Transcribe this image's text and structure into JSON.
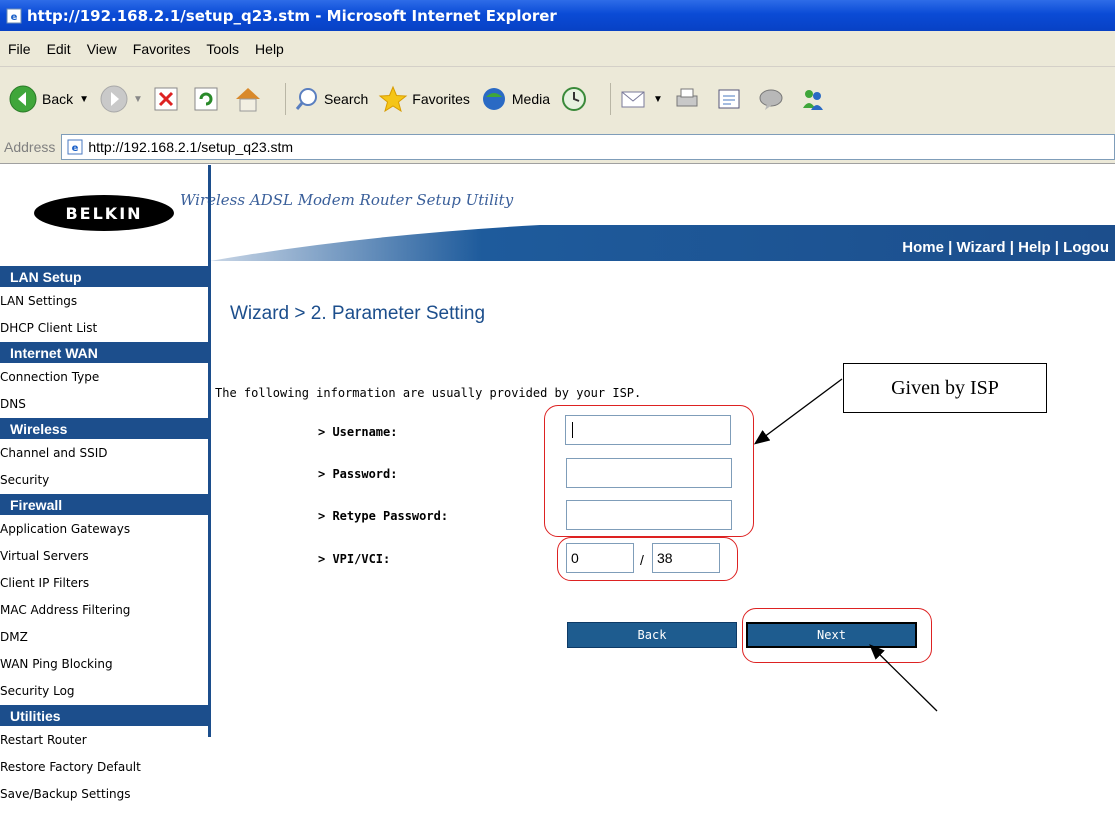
{
  "window": {
    "title": "http://192.168.2.1/setup_q23.stm - Microsoft Internet Explorer"
  },
  "menu": [
    "File",
    "Edit",
    "View",
    "Favorites",
    "Tools",
    "Help"
  ],
  "toolbar": {
    "back": "Back",
    "search": "Search",
    "favorites": "Favorites",
    "media": "Media"
  },
  "address": {
    "label": "Address",
    "url": "http://192.168.2.1/setup_q23.stm"
  },
  "brand": {
    "logo": "BELKIN",
    "tagline": "Wireless ADSL Modem Router Setup Utility"
  },
  "toplinks": {
    "home": "Home",
    "sep": " | ",
    "wizard": "Wizard",
    "help": "Help",
    "logout": "Logou"
  },
  "sidebar": {
    "lan": {
      "title": "LAN Setup",
      "items": [
        "LAN Settings",
        "DHCP Client List"
      ]
    },
    "wan": {
      "title": "Internet WAN",
      "items": [
        "Connection Type",
        "DNS"
      ]
    },
    "wireless": {
      "title": "Wireless",
      "items": [
        "Channel and SSID",
        "Security"
      ]
    },
    "firewall": {
      "title": "Firewall",
      "items": [
        "Application Gateways",
        "Virtual Servers",
        "Client IP Filters",
        "MAC Address Filtering",
        "DMZ",
        "WAN Ping Blocking",
        "Security Log"
      ]
    },
    "utilities": {
      "title": "Utilities",
      "items": [
        "Restart Router",
        "Restore Factory Default",
        "Save/Backup Settings"
      ]
    }
  },
  "main": {
    "title": "Wizard > 2. Parameter Setting",
    "info": "The following information are usually provided by your ISP.",
    "username_label": "> Username:",
    "password_label": "> Password:",
    "retype_label": "> Retype Password:",
    "vpivci_label": "> VPI/VCI:",
    "username_value": "",
    "password_value": "",
    "retype_value": "",
    "vpi_value": "0",
    "vci_value": "38",
    "slash": "/",
    "back_button": "Back",
    "next_button": "Next"
  },
  "annotation": {
    "callout": "Given by ISP"
  },
  "colors": {
    "accent": "#1c4e8c",
    "highlight": "#dd2222"
  }
}
